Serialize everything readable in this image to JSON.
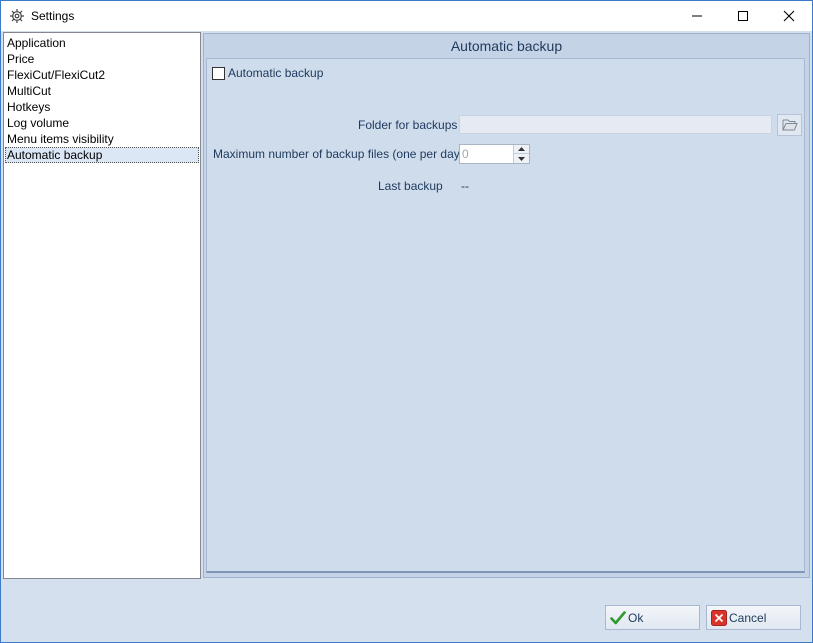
{
  "window": {
    "title": "Settings"
  },
  "titlebar_controls": {
    "minimize": "—",
    "maximize": "☐",
    "close": "✕"
  },
  "sidebar": {
    "items": [
      {
        "label": "Application"
      },
      {
        "label": "Price"
      },
      {
        "label": "FlexiCut/FlexiCut2"
      },
      {
        "label": "MultiCut"
      },
      {
        "label": "Hotkeys"
      },
      {
        "label": "Log volume"
      },
      {
        "label": "Menu items visibility"
      },
      {
        "label": "Automatic backup"
      }
    ],
    "selected": "Automatic backup"
  },
  "panel": {
    "header": "Automatic backup",
    "enable_checkbox": {
      "label": "Automatic backup",
      "checked": false
    },
    "folder": {
      "label": "Folder for backups",
      "value": ""
    },
    "max_files": {
      "label": "Maximum number of backup files (one per day)",
      "value": "0"
    },
    "last_backup": {
      "label": "Last backup",
      "value": "--"
    }
  },
  "footer": {
    "ok_label": "Ok",
    "cancel_label": "Cancel"
  },
  "icons": {
    "app": "gear-icon",
    "folder_browse": "folder-open-icon",
    "ok": "checkmark-icon",
    "cancel": "x-box-icon"
  },
  "colors": {
    "accent_border": "#3b79c9",
    "panel_bg": "#cfdcec",
    "label_text": "#1e395b"
  }
}
